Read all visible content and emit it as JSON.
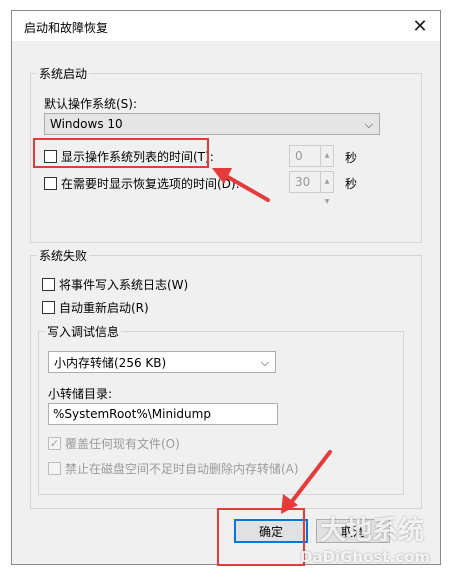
{
  "window": {
    "title": "启动和故障恢复",
    "close_glyph": "✕"
  },
  "system_startup": {
    "legend": "系统启动",
    "default_os_label": "默认操作系统(S):",
    "default_os_value": "Windows 10",
    "show_list_label": "显示操作系统列表的时间(T):",
    "show_list_checked": false,
    "show_list_value": "0",
    "show_recovery_label": "在需要时显示恢复选项的时间(D):",
    "show_recovery_checked": false,
    "show_recovery_value": "30",
    "unit": "秒"
  },
  "system_failure": {
    "legend": "系统失败",
    "write_event_label": "将事件写入系统日志(W)",
    "write_event_checked": false,
    "auto_restart_label": "自动重新启动(R)",
    "auto_restart_checked": false,
    "debug_info": {
      "legend": "写入调试信息",
      "dump_type_value": "小内存转储(256 KB)",
      "dump_dir_label": "小转储目录:",
      "dump_dir_value": "%SystemRoot%\\Minidump",
      "overwrite_label": "覆盖任何现有文件(O)",
      "overwrite_checked": true,
      "disable_auto_delete_label": "禁止在磁盘空间不足时自动删除内存转储(A)",
      "disable_auto_delete_checked": false
    }
  },
  "buttons": {
    "ok_label": "确定",
    "cancel_label": "取消"
  },
  "annotations": {
    "highlight_color": "#e53b3b"
  },
  "watermark": {
    "brand": "大地系统",
    "url": "DaDiGhost.com"
  }
}
